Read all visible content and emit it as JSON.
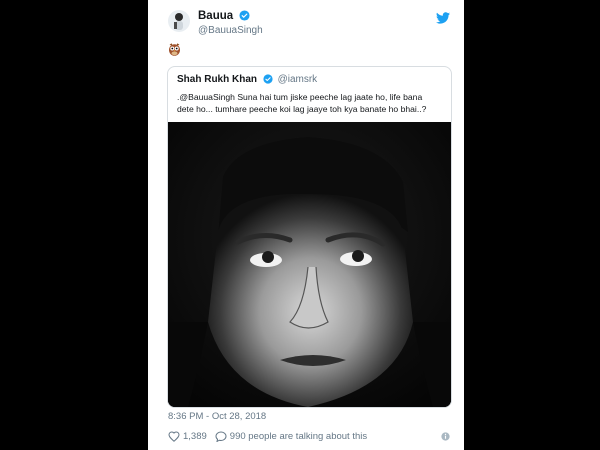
{
  "author": {
    "name": "Bauua",
    "handle": "@BauuaSingh"
  },
  "quoted": {
    "name": "Shah Rukh Khan",
    "handle": "@iamsrk",
    "text_line1": ".@BauuaSingh Suna hai tum jiske peeche lag jaate ho, life bana",
    "text_line2": "dete ho... tumhare peeche koi lag jaaye toh kya banate ho bhai..?"
  },
  "timestamp": "8:36 PM - Oct 28, 2018",
  "stats": {
    "likes": "1,389",
    "talking": "990 people are talking about this"
  },
  "colors": {
    "twitter_blue": "#1da1f2",
    "text": "#14171a",
    "muted": "#657786"
  },
  "icons": [
    "verified-badge-icon",
    "twitter-bird-icon",
    "owl-emoji-icon",
    "heart-icon",
    "speech-bubble-icon",
    "info-icon"
  ]
}
